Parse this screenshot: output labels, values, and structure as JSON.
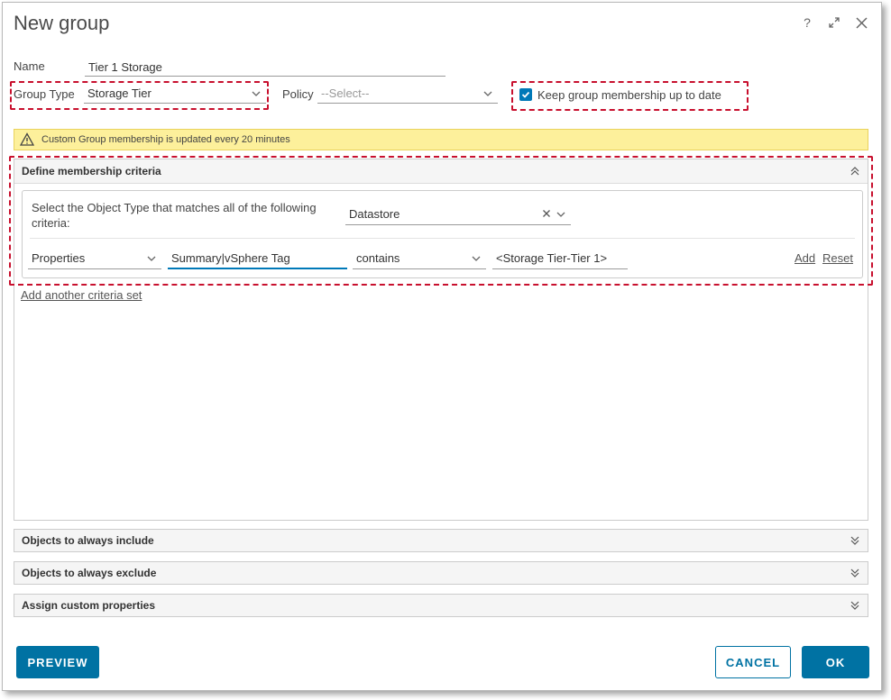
{
  "dialog": {
    "title": "New group",
    "header_icons": [
      "help-icon",
      "expand-icon",
      "close-icon"
    ],
    "help_glyph": "?"
  },
  "form": {
    "name_label": "Name",
    "name_value": "Tier 1 Storage",
    "group_type_label": "Group Type",
    "group_type_value": "Storage Tier",
    "policy_label": "Policy",
    "policy_placeholder": "--Select--",
    "keep_updated_label": "Keep group membership up to date",
    "keep_updated_checked": true
  },
  "alert": {
    "text": "Custom Group membership is updated every 20 minutes"
  },
  "membership": {
    "header": "Define membership criteria",
    "criteria_text": "Select the Object Type that matches all of the following criteria:",
    "object_type": "Datastore",
    "row": {
      "field_type": "Properties",
      "property": "Summary|vSphere Tag",
      "operator": "contains",
      "value": "<Storage Tier-Tier 1>",
      "add_label": "Add",
      "reset_label": "Reset"
    },
    "add_set_label": "Add another criteria set"
  },
  "sections": [
    {
      "label": "Objects to always include"
    },
    {
      "label": "Objects to always exclude"
    },
    {
      "label": "Assign custom properties"
    }
  ],
  "footer": {
    "preview_label": "PREVIEW",
    "cancel_label": "CANCEL",
    "ok_label": "OK"
  },
  "colors": {
    "accent": "#0072a3",
    "highlight_dash": "#c8102e",
    "alert_bg": "#fdf09b"
  }
}
